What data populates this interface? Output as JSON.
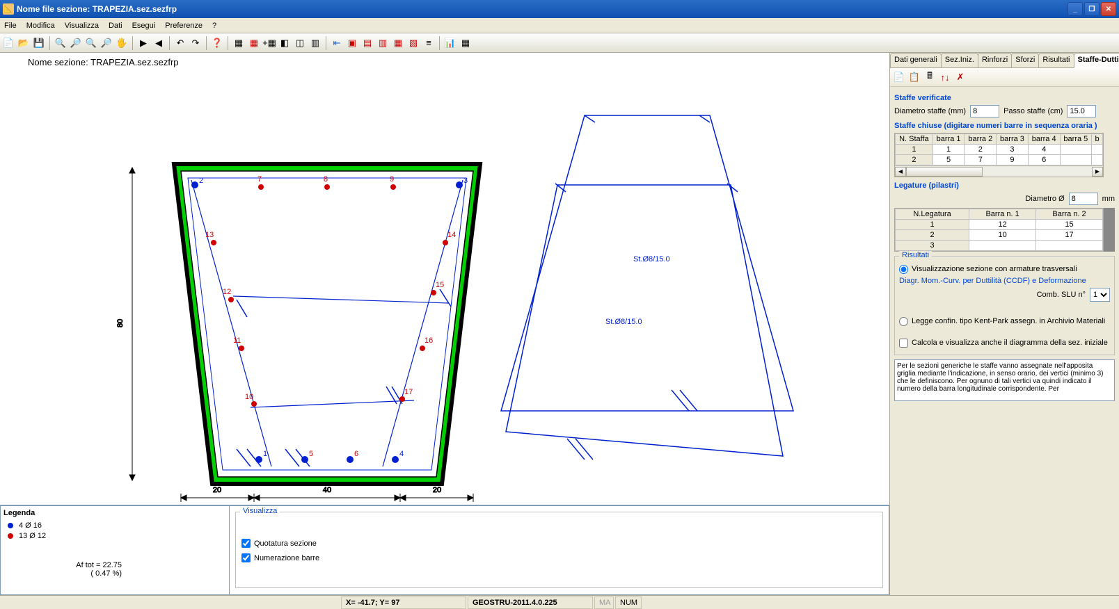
{
  "window": {
    "title": "Nome file sezione: TRAPEZIA.sez.sezfrp"
  },
  "menu": [
    "File",
    "Modifica",
    "Visualizza",
    "Dati",
    "Esegui",
    "Preferenze",
    "?"
  ],
  "canvas": {
    "section_label": "Nome sezione: TRAPEZIA.sez.sezfrp",
    "dim_height": "80",
    "dim_b1": "20",
    "dim_b2": "40",
    "dim_b3": "20",
    "stirrup_label": "St.Ø8/15.0",
    "bars_blue": [
      "1",
      "2",
      "3",
      "4",
      "5",
      "6"
    ],
    "bars_red": [
      "7",
      "8",
      "9",
      "10",
      "11",
      "12",
      "13",
      "14",
      "15",
      "16",
      "17"
    ]
  },
  "legend": {
    "title": "Legenda",
    "items": [
      {
        "color": "#0020d0",
        "label": "4 Ø 16"
      },
      {
        "color": "#d00000",
        "label": "13 Ø 12"
      }
    ],
    "total1": "Af tot = 22.75",
    "total2": "( 0.47 %)"
  },
  "viz": {
    "group": "Visualizza",
    "opt1": "Quotatura sezione",
    "opt2": "Numerazione barre"
  },
  "tabs": [
    "Dati generali",
    "Sez.Iniz.",
    "Rinforzi",
    "Sforzi",
    "Risultati",
    "Staffe-Duttilità"
  ],
  "panel": {
    "s1_title": "Staffe verificate",
    "diam_label": "Diametro staffe (mm)",
    "diam_val": "8",
    "passo_label": "Passo staffe (cm)",
    "passo_val": "15.0",
    "s2_title": "Staffe chiuse (digitare numeri barre in sequenza oraria )",
    "staffe_headers": [
      "N. Staffa",
      "barra 1",
      "barra 2",
      "barra 3",
      "barra 4",
      "barra 5",
      "b"
    ],
    "staffe_rows": [
      [
        "1",
        "1",
        "2",
        "3",
        "4",
        ""
      ],
      [
        "2",
        "5",
        "7",
        "9",
        "6",
        ""
      ]
    ],
    "s3_title": "Legature (pilastri)",
    "leg_diam_label": "Diametro Ø",
    "leg_diam_val": "8",
    "leg_diam_unit": "mm",
    "leg_headers": [
      "N.Legatura",
      "Barra n. 1",
      "Barra n. 2"
    ],
    "leg_rows": [
      [
        "1",
        "12",
        "15"
      ],
      [
        "2",
        "10",
        "17"
      ],
      [
        "3",
        "",
        ""
      ]
    ],
    "res_title": "Risultati",
    "res_radio1": "Visualizzazione sezione con armature trasversali",
    "res_link": "Diagr. Mom.-Curv. per Duttilità (CCDF) e Deformazione",
    "comb_label": "Comb. SLU n°",
    "comb_val": "1",
    "res_radio2": "Legge confin. tipo Kent-Park  assegn. in Archivio Materiali",
    "res_check": "Calcola e visualizza anche il diagramma della sez. iniziale",
    "hint": "Per le sezioni generiche le staffe vanno assegnate nell'apposita griglia mediante l'indicazione, in senso orario, dei vertici (minimo 3) che le definiscono. Per ognuno di tali vertici va quindi indicato il numero della barra longitudinale corrispondente.  Per"
  },
  "status": {
    "coords": "X= -41.7;  Y=  97",
    "ver": "GEOSTRU-2011.4.0.225",
    "ma": "MA",
    "num": "NUM"
  }
}
